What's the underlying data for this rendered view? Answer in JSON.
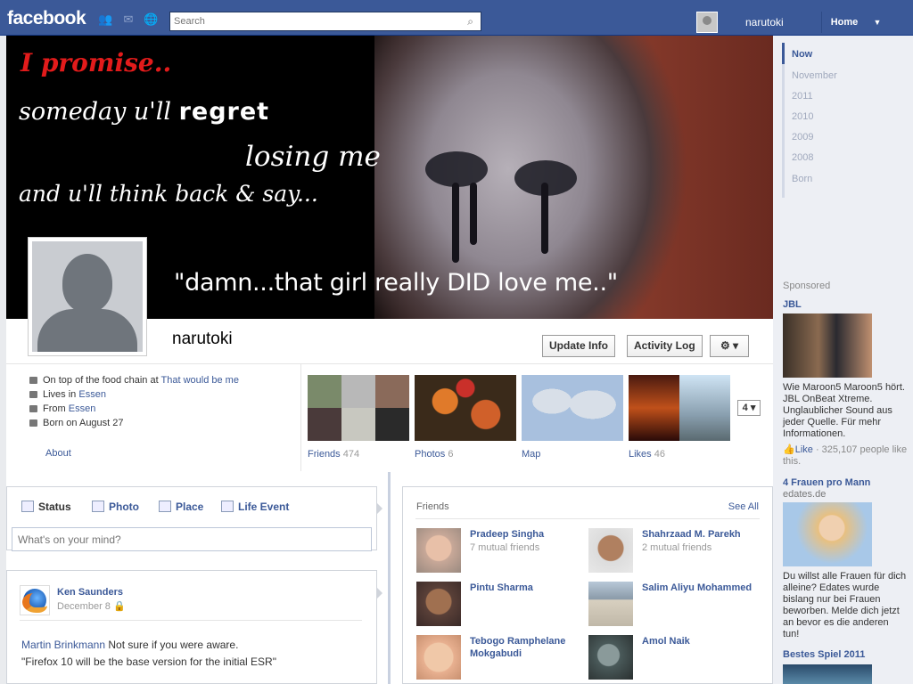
{
  "topbar": {
    "logo": "facebook",
    "search_placeholder": "Search",
    "user": "narutoki",
    "home": "Home"
  },
  "cover": {
    "line1": "I promise..",
    "line2a": "someday u'll ",
    "line2b": "regret",
    "line3": "losing me",
    "line4": "and u'll think back & say...",
    "quote": "\"damn...that girl really DID love me..\""
  },
  "profile": {
    "name": "narutoki",
    "update_info": "Update Info",
    "activity_log": "Activity Log",
    "gear": "⚙ ▾"
  },
  "info": {
    "items": [
      {
        "text": "On top of the food chain at ",
        "link": "That would be me"
      },
      {
        "text": "Lives in ",
        "link": "Essen"
      },
      {
        "text": "From ",
        "link": "Essen"
      },
      {
        "text": "Born on August 27",
        "link": ""
      }
    ],
    "about": "About",
    "tiles": [
      {
        "label": "Friends",
        "count": "474"
      },
      {
        "label": "Photos",
        "count": "6"
      },
      {
        "label": "Map",
        "count": ""
      },
      {
        "label": "Likes",
        "count": "46"
      }
    ],
    "more": "4 ▾"
  },
  "composer": {
    "tabs": [
      "Status",
      "Photo",
      "Place",
      "Life Event"
    ],
    "placeholder": "What's on your mind?"
  },
  "post": {
    "author": "Ken Saunders",
    "date": "December 8",
    "mention": "Martin Brinkmann",
    "line1": " Not sure if you were aware.",
    "line2": "\"Firefox 10 will be the base version for the initial ESR\""
  },
  "friends": {
    "title": "Friends",
    "see_all": "See All",
    "list": [
      {
        "name": "Pradeep Singha",
        "mutual": "7 mutual friends"
      },
      {
        "name": "Shahrzaad M. Parekh",
        "mutual": "2 mutual friends"
      },
      {
        "name": "Pintu Sharma",
        "mutual": ""
      },
      {
        "name": "Salim Aliyu Mohammed",
        "mutual": ""
      },
      {
        "name": "Tebogo Ramphelane Mokgabudi",
        "mutual": ""
      },
      {
        "name": "Amol Naik",
        "mutual": ""
      }
    ]
  },
  "sidebar": {
    "years": [
      "Now",
      "November",
      "2011",
      "2010",
      "2009",
      "2008",
      "Born"
    ],
    "sponsored": "Sponsored",
    "ads": [
      {
        "title": "JBL",
        "sub": "",
        "text": "Wie Maroon5 Maroon5 hört. JBL OnBeat Xtreme. Unglaublicher Sound aus jeder Quelle. Für mehr Informationen.",
        "like_link": "Like",
        "like_text": " · 325,107 people like this."
      },
      {
        "title": "4 Frauen pro Mann",
        "sub": "edates.de",
        "text": "Du willst alle Frauen für dich alleine? Edates wurde bislang nur bei Frauen beworben. Melde dich jetzt an bevor es die anderen tun!",
        "like_link": "",
        "like_text": ""
      },
      {
        "title": "Bestes Spiel 2011",
        "sub": "",
        "text": "",
        "like_link": "",
        "like_text": ""
      }
    ]
  },
  "colors": {
    "brand": "#3b5998",
    "link": "#3b5998",
    "background": "#e9ebee"
  }
}
